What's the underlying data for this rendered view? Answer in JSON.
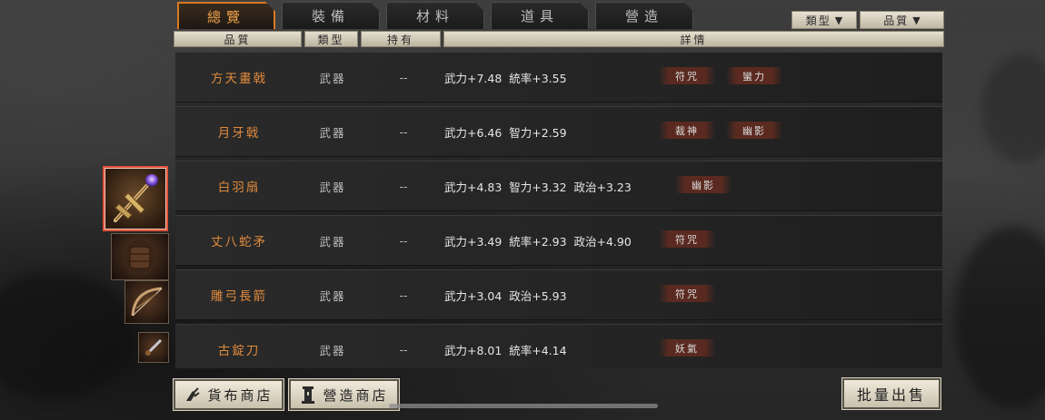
{
  "tabs": [
    "總覽",
    "裝備",
    "材料",
    "道具",
    "營造"
  ],
  "active_tab": 0,
  "filters": {
    "type_label": "類型",
    "quality_label": "品質",
    "arrow": "▼"
  },
  "columns": {
    "quality": "品質",
    "type": "類型",
    "owned": "持有",
    "details": "詳情"
  },
  "items": [
    {
      "name": "方天畫戟",
      "type": "武器",
      "owned": "--",
      "details": "武力+7.48  統率+3.55",
      "tags": [
        "符咒",
        "蠻力"
      ]
    },
    {
      "name": "月牙戟",
      "type": "武器",
      "owned": "--",
      "details": "武力+6.46  智力+2.59",
      "tags": [
        "裁神",
        "幽影"
      ]
    },
    {
      "name": "白羽扇",
      "type": "武器",
      "owned": "--",
      "details": "武力+4.83  智力+3.32  政治+3.23",
      "tags": [
        "幽影"
      ]
    },
    {
      "name": "丈八蛇矛",
      "type": "武器",
      "owned": "--",
      "details": "武力+3.49  統率+2.93  政治+4.90",
      "tags": [
        "符咒"
      ]
    },
    {
      "name": "雕弓長箭",
      "type": "武器",
      "owned": "--",
      "details": "武力+3.04  政治+5.93",
      "tags": [
        "符咒"
      ]
    },
    {
      "name": "古錠刀",
      "type": "武器",
      "owned": "--",
      "details": "武力+8.01  統率+4.14",
      "tags": [
        "妖氣"
      ]
    }
  ],
  "buttons": {
    "currency_shop": "貨布商店",
    "construction_shop": "營造商店",
    "bulk_sell": "批量出售"
  },
  "colors": {
    "accent": "#e08a3c",
    "tab_active_border": "#d67a22",
    "tag_bg": "#5a2a20",
    "selected_thumb": "#e0533a"
  }
}
